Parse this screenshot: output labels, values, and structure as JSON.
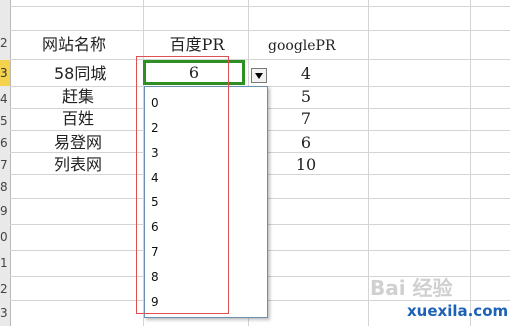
{
  "row_numbers": [
    "2",
    "3",
    "4",
    "5",
    "6",
    "7",
    "8",
    "9",
    "0",
    "1",
    "2",
    "3"
  ],
  "active_row_number": "3",
  "headers": {
    "site_name": "网站名称",
    "baidu_pr": "百度PR",
    "google_pr": "googlePR"
  },
  "rows": [
    {
      "site": "58同城",
      "baidu": "6",
      "google": "4"
    },
    {
      "site": "赶集",
      "baidu": "",
      "google": "5"
    },
    {
      "site": "百姓",
      "baidu": "",
      "google": "7"
    },
    {
      "site": "易登网",
      "baidu": "",
      "google": "6"
    },
    {
      "site": "列表网",
      "baidu": "",
      "google": "10"
    }
  ],
  "dropdown_options": [
    "0",
    "2",
    "3",
    "4",
    "5",
    "6",
    "7",
    "8",
    "9"
  ],
  "colors": {
    "active_cell_border": "#2e8f22",
    "annotation_box": "#e05050",
    "watermark_url": "#1e62b6"
  },
  "icons": {
    "dropdown_button": "chevron-down-icon"
  },
  "watermark": {
    "brand": "Bai 经验",
    "url": "xuexila.com"
  }
}
